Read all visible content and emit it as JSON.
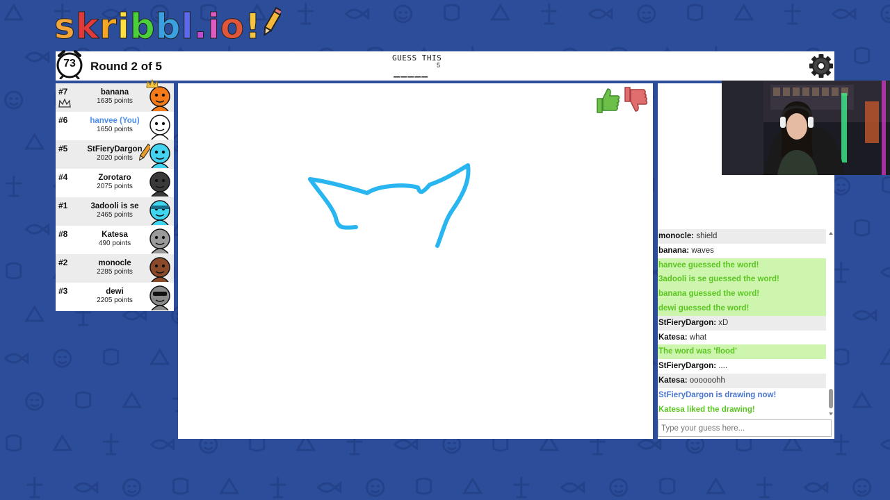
{
  "logo": {
    "letters": [
      "s",
      "k",
      "r",
      "i",
      "b",
      "b",
      "l",
      ".",
      "i",
      "o",
      "!"
    ],
    "colors": [
      "#f0a43a",
      "#e03a3a",
      "#f5a623",
      "#ffdf3c",
      "#4ccf3c",
      "#3aa0e0",
      "#5b6af0",
      "#c04ad0",
      "#e05ac0",
      "#e0563a",
      "#f5c542"
    ]
  },
  "header": {
    "timer": "73",
    "round": "Round 2 of 5",
    "guess_label": "GUESS THIS",
    "word_hint": "_____",
    "word_length": "5"
  },
  "players": [
    {
      "rank": "#7",
      "name": "banana",
      "points": "1635 points",
      "you": false,
      "avatar_color": "#f57b1a",
      "crown": true
    },
    {
      "rank": "#6",
      "name": "hanvee (You)",
      "points": "1650 points",
      "you": true,
      "avatar_color": "#ffffff"
    },
    {
      "rank": "#5",
      "name": "StFieryDargon",
      "points": "2020 points",
      "you": false,
      "avatar_color": "#43d3f0",
      "drawing": true
    },
    {
      "rank": "#4",
      "name": "Zorotaro",
      "points": "2075 points",
      "you": false,
      "avatar_color": "#3a3a3a"
    },
    {
      "rank": "#1",
      "name": "3adooli is se",
      "points": "2465 points",
      "you": false,
      "avatar_color": "#3fd6f0"
    },
    {
      "rank": "#8",
      "name": "Katesa",
      "points": "490 points",
      "you": false,
      "avatar_color": "#9a9a9a"
    },
    {
      "rank": "#2",
      "name": "monocle",
      "points": "2285 points",
      "you": false,
      "avatar_color": "#8a4a2a"
    },
    {
      "rank": "#3",
      "name": "dewi",
      "points": "2205 points",
      "you": false,
      "avatar_color": "#8a8a8a"
    }
  ],
  "chat": [
    {
      "author": "monocle",
      "text": "shield",
      "type": "normal"
    },
    {
      "author": "banana",
      "text": "waves",
      "type": "normal"
    },
    {
      "text": "hanvee guessed the word!",
      "type": "green"
    },
    {
      "text": "3adooli is se guessed the word!",
      "type": "green"
    },
    {
      "text": "banana guessed the word!",
      "type": "green"
    },
    {
      "text": "dewi guessed the word!",
      "type": "green"
    },
    {
      "author": "StFieryDargon",
      "text": "xD",
      "type": "normal"
    },
    {
      "author": "Katesa",
      "text": "what",
      "type": "normal"
    },
    {
      "text": "The word was 'flood'",
      "type": "green"
    },
    {
      "author": "StFieryDargon",
      "text": "....",
      "type": "normal"
    },
    {
      "author": "Katesa",
      "text": "oooooohh",
      "type": "normal"
    },
    {
      "text": "StFieryDargon is drawing now!",
      "type": "blue"
    },
    {
      "text": "Katesa liked the drawing!",
      "type": "green-lite"
    }
  ],
  "chat_input": {
    "placeholder": "Type your guess here..."
  },
  "colors": {
    "background": "#2b4d9a",
    "brush": "#29b6f0",
    "green_text": "#5bc623",
    "blue_text": "#4a76cf",
    "you_text": "#4a8ef0"
  }
}
